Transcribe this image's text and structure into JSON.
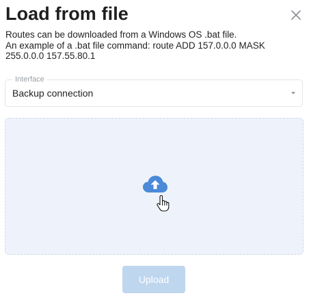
{
  "dialog": {
    "title": "Load from file",
    "description_line1": "Routes can be downloaded from a Windows OS .bat file.",
    "description_line2": "An example of a .bat file command: route ADD 157.0.0.0 MASK 255.0.0.0 157.55.80.1"
  },
  "interface_select": {
    "label": "Interface",
    "value": "Backup connection"
  },
  "dropzone": {
    "icon": "cloud-upload-icon",
    "cursor_icon": "hand-pointer-icon"
  },
  "actions": {
    "upload_label": "Upload",
    "upload_enabled": false
  },
  "colors": {
    "accent": "#4a8ad8",
    "dropzone_bg": "#eef3fb",
    "upload_disabled_bg": "#bfd6ef"
  }
}
